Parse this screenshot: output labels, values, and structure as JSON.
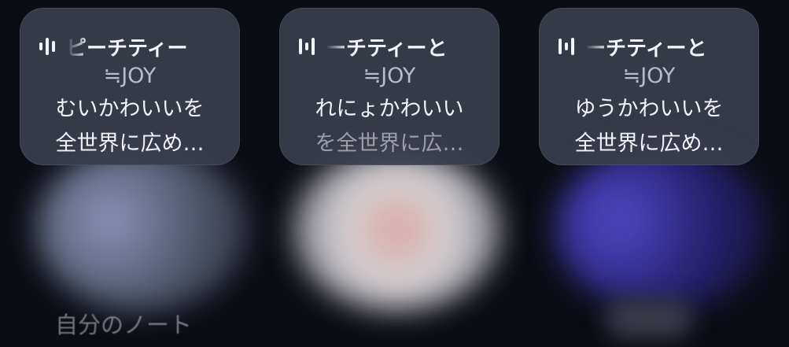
{
  "notes": [
    {
      "title": "ピーチティー",
      "artist": "≒JOY",
      "message_line1": "むいかわいいを",
      "message_line2": "全世界に広め…"
    },
    {
      "title": "ーチティーと",
      "artist": "≒JOY",
      "message_line1": "れにょかわいい",
      "message_line2": "を全世界に広…"
    },
    {
      "title": "ーチティーと",
      "artist": "≒JOY",
      "message_line1": "ゆうかわいいを",
      "message_line2": "全世界に広め…"
    }
  ],
  "caption": "自分のノート",
  "icons": {
    "audio": "audio-waveform-icon"
  }
}
